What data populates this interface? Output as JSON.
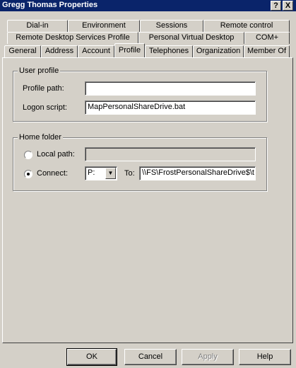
{
  "window": {
    "title": "Gregg Thomas Properties",
    "help_glyph": "?",
    "close_glyph": "X"
  },
  "tabs": {
    "row1": [
      "Dial-in",
      "Environment",
      "Sessions",
      "Remote control"
    ],
    "row2": [
      "Remote Desktop Services Profile",
      "Personal Virtual Desktop",
      "COM+"
    ],
    "row3": [
      "General",
      "Address",
      "Account",
      "Profile",
      "Telephones",
      "Organization",
      "Member Of"
    ],
    "active": "Profile"
  },
  "user_profile": {
    "legend": "User profile",
    "profile_path_label": "Profile path:",
    "profile_path_value": "",
    "logon_script_label": "Logon script:",
    "logon_script_value": "MapPersonalShareDrive.bat"
  },
  "home_folder": {
    "legend": "Home folder",
    "local_path_label": "Local path:",
    "local_path_value": "",
    "connect_label": "Connect:",
    "drive_value": "P:",
    "to_label": "To:",
    "to_value": "\\\\FS\\FrostPersonalShareDrive$\\t",
    "selected_option": "Connect"
  },
  "buttons": {
    "ok": "OK",
    "cancel": "Cancel",
    "apply": "Apply",
    "help": "Help"
  },
  "colors": {
    "titlebar": "#0a246a",
    "face": "#d4d0c8"
  }
}
